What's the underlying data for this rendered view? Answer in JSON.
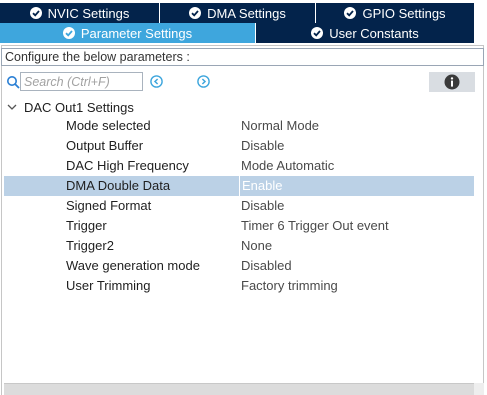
{
  "tabs_top": [
    {
      "label": "NVIC Settings",
      "icon": "check-circle-icon"
    },
    {
      "label": "DMA Settings",
      "icon": "check-circle-icon"
    },
    {
      "label": "GPIO Settings",
      "icon": "check-circle-icon"
    }
  ],
  "tabs_bottom": [
    {
      "label": "Parameter Settings",
      "icon": "check-circle-icon",
      "active": true
    },
    {
      "label": "User Constants",
      "icon": "check-circle-icon",
      "active": false
    }
  ],
  "config_bar": {
    "text": "Configure the below parameters :"
  },
  "search": {
    "placeholder": "Search (Ctrl+F)",
    "value": ""
  },
  "group": {
    "label": "DAC Out1 Settings",
    "expanded": true
  },
  "params": [
    {
      "name": "Mode selected",
      "value": "Normal Mode"
    },
    {
      "name": "Output Buffer",
      "value": "Disable"
    },
    {
      "name": "DAC High Frequency",
      "value": "Mode Automatic"
    },
    {
      "name": "DMA Double Data",
      "value": "Enable",
      "selected": true
    },
    {
      "name": "Signed Format",
      "value": "Disable"
    },
    {
      "name": "Trigger",
      "value": "Timer 6 Trigger Out event"
    },
    {
      "name": "Trigger2",
      "value": "None"
    },
    {
      "name": "Wave generation mode",
      "value": "Disabled"
    },
    {
      "name": "User Trimming",
      "value": "Factory trimming"
    }
  ],
  "colors": {
    "tab_dark": "#03234b",
    "tab_active": "#3ea6dd",
    "selected_row": "#bbd1e6",
    "nav_accent": "#3ea6dd"
  }
}
